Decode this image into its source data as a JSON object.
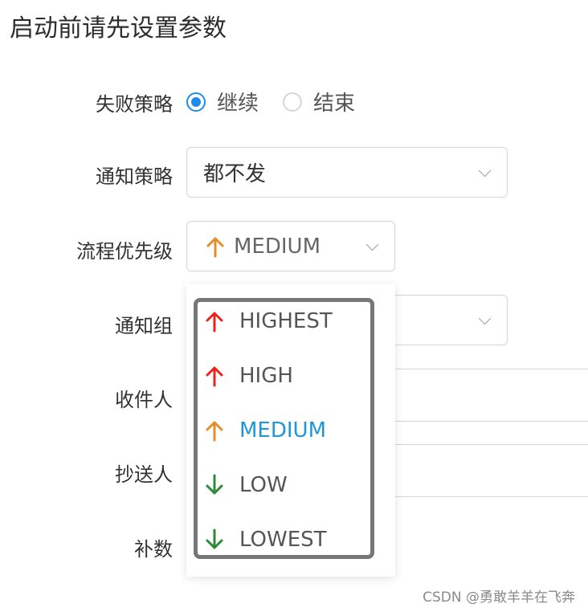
{
  "header": {
    "title": "启动前请先设置参数"
  },
  "form": {
    "failure_strategy": {
      "label": "失败策略",
      "options": [
        "继续",
        "结束"
      ],
      "selected": "继续"
    },
    "notify_strategy": {
      "label": "通知策略",
      "value": "都不发"
    },
    "priority": {
      "label": "流程优先级",
      "value": "MEDIUM"
    },
    "notify_group": {
      "label": "通知组"
    },
    "recipients": {
      "label": "收件人"
    },
    "cc": {
      "label": "抄送人"
    },
    "backfill": {
      "label": "补数"
    }
  },
  "dropdown": {
    "options": [
      {
        "label": "HIGHEST",
        "direction": "up",
        "color": "#e8231c"
      },
      {
        "label": "HIGH",
        "direction": "up",
        "color": "#e8231c"
      },
      {
        "label": "MEDIUM",
        "direction": "up",
        "color": "#e38d2d",
        "selected": true
      },
      {
        "label": "LOW",
        "direction": "down",
        "color": "#2d8b3a"
      },
      {
        "label": "LOWEST",
        "direction": "down",
        "color": "#2d8b3a"
      }
    ]
  },
  "colors": {
    "accent": "#1f8ceb",
    "selected_text": "#1f96d6"
  },
  "watermark": "CSDN @勇敢羊羊在飞奔"
}
